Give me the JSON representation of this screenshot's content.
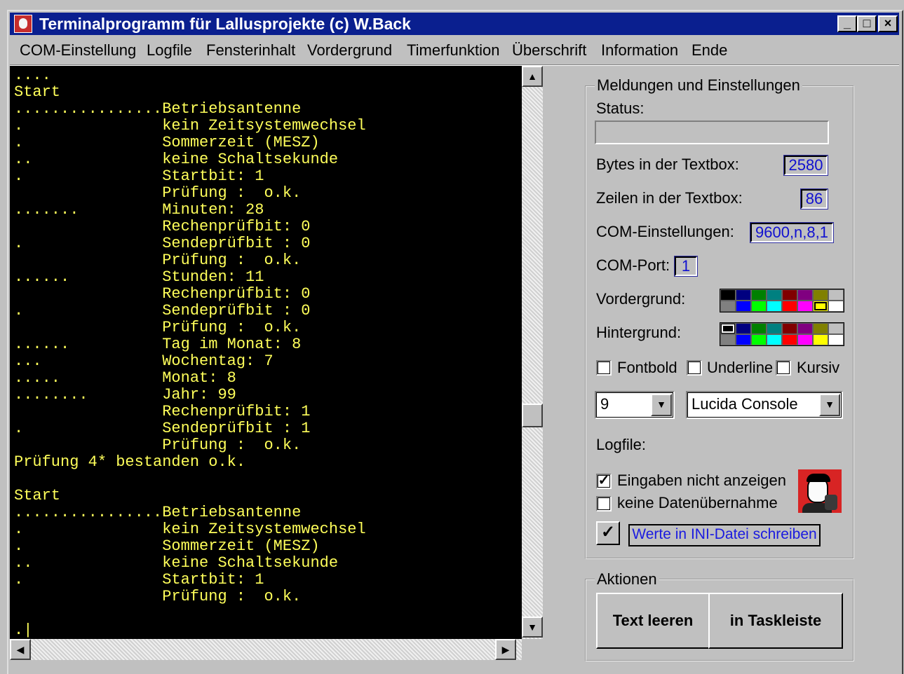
{
  "window": {
    "title": "Terminalprogramm für Lallusprojekte (c) W.Back",
    "minimize": "_",
    "maximize": "□",
    "close": "×"
  },
  "menu": {
    "items": [
      "COM-Einstellung",
      "Logfile",
      "Fensterinhalt",
      "Vordergrund",
      "Timerfunktion",
      "Überschrift",
      "Information",
      "Ende"
    ]
  },
  "terminal": {
    "text": "....\nStart\n................Betriebsantenne\n.               kein Zeitsystemwechsel\n.               Sommerzeit (MESZ)\n..              keine Schaltsekunde\n.               Startbit: 1\n                Prüfung :  o.k.\n.......         Minuten: 28\n                Rechenprüfbit: 0\n.               Sendeprüfbit : 0\n                Prüfung :  o.k.\n......          Stunden: 11\n                Rechenprüfbit: 0\n.               Sendeprüfbit : 0\n                Prüfung :  o.k.\n......          Tag im Monat: 8\n...             Wochentag: 7\n.....           Monat: 8\n........        Jahr: 99\n                Rechenprüfbit: 1\n.               Sendeprüfbit : 1\n                Prüfung :  o.k.\nPrüfung 4* bestanden o.k.\n\nStart\n................Betriebsantenne\n.               kein Zeitsystemwechsel\n.               Sommerzeit (MESZ)\n..              keine Schaltsekunde\n.               Startbit: 1\n                Prüfung :  o.k.\n\n.|",
    "text_color": "#ffff5a",
    "background": "#000000"
  },
  "settings": {
    "group_label": "Meldungen und Einstellungen",
    "status_label": "Status:",
    "status_value": "",
    "bytes_label": "Bytes in der Textbox:",
    "bytes_value": "2580",
    "lines_label": "Zeilen in der Textbox:",
    "lines_value": "86",
    "com_settings_label": "COM-Einstellungen:",
    "com_settings_value": "9600,n,8,1",
    "com_port_label": "COM-Port:",
    "com_port_value": "1",
    "foreground_label": "Vordergrund:",
    "background_label": "Hintergrund:",
    "fontbold_label": "Fontbold",
    "underline_label": "Underline",
    "italic_label": "Kursiv",
    "fontsize_value": "9",
    "fontname_value": "Lucida Console",
    "logfile_label": "Logfile:",
    "hide_input_label": "Eingaben nicht anzeigen",
    "hide_input_checked": "✓",
    "no_transfer_label": "keine Datenübernahme",
    "write_ini_check": "✓",
    "write_ini_label": "Werte in INI-Datei schreiben"
  },
  "actions": {
    "group_label": "Aktionen",
    "clear_button": "Text leeren",
    "taskbar_button": "in Taskleiste"
  },
  "palette_colors": [
    "#000000",
    "#000080",
    "#008000",
    "#008080",
    "#800000",
    "#800080",
    "#808000",
    "#c0c0c0",
    "#808080",
    "#0000ff",
    "#00ff00",
    "#00ffff",
    "#ff0000",
    "#ff00ff",
    "#ffff00",
    "#ffffff"
  ]
}
